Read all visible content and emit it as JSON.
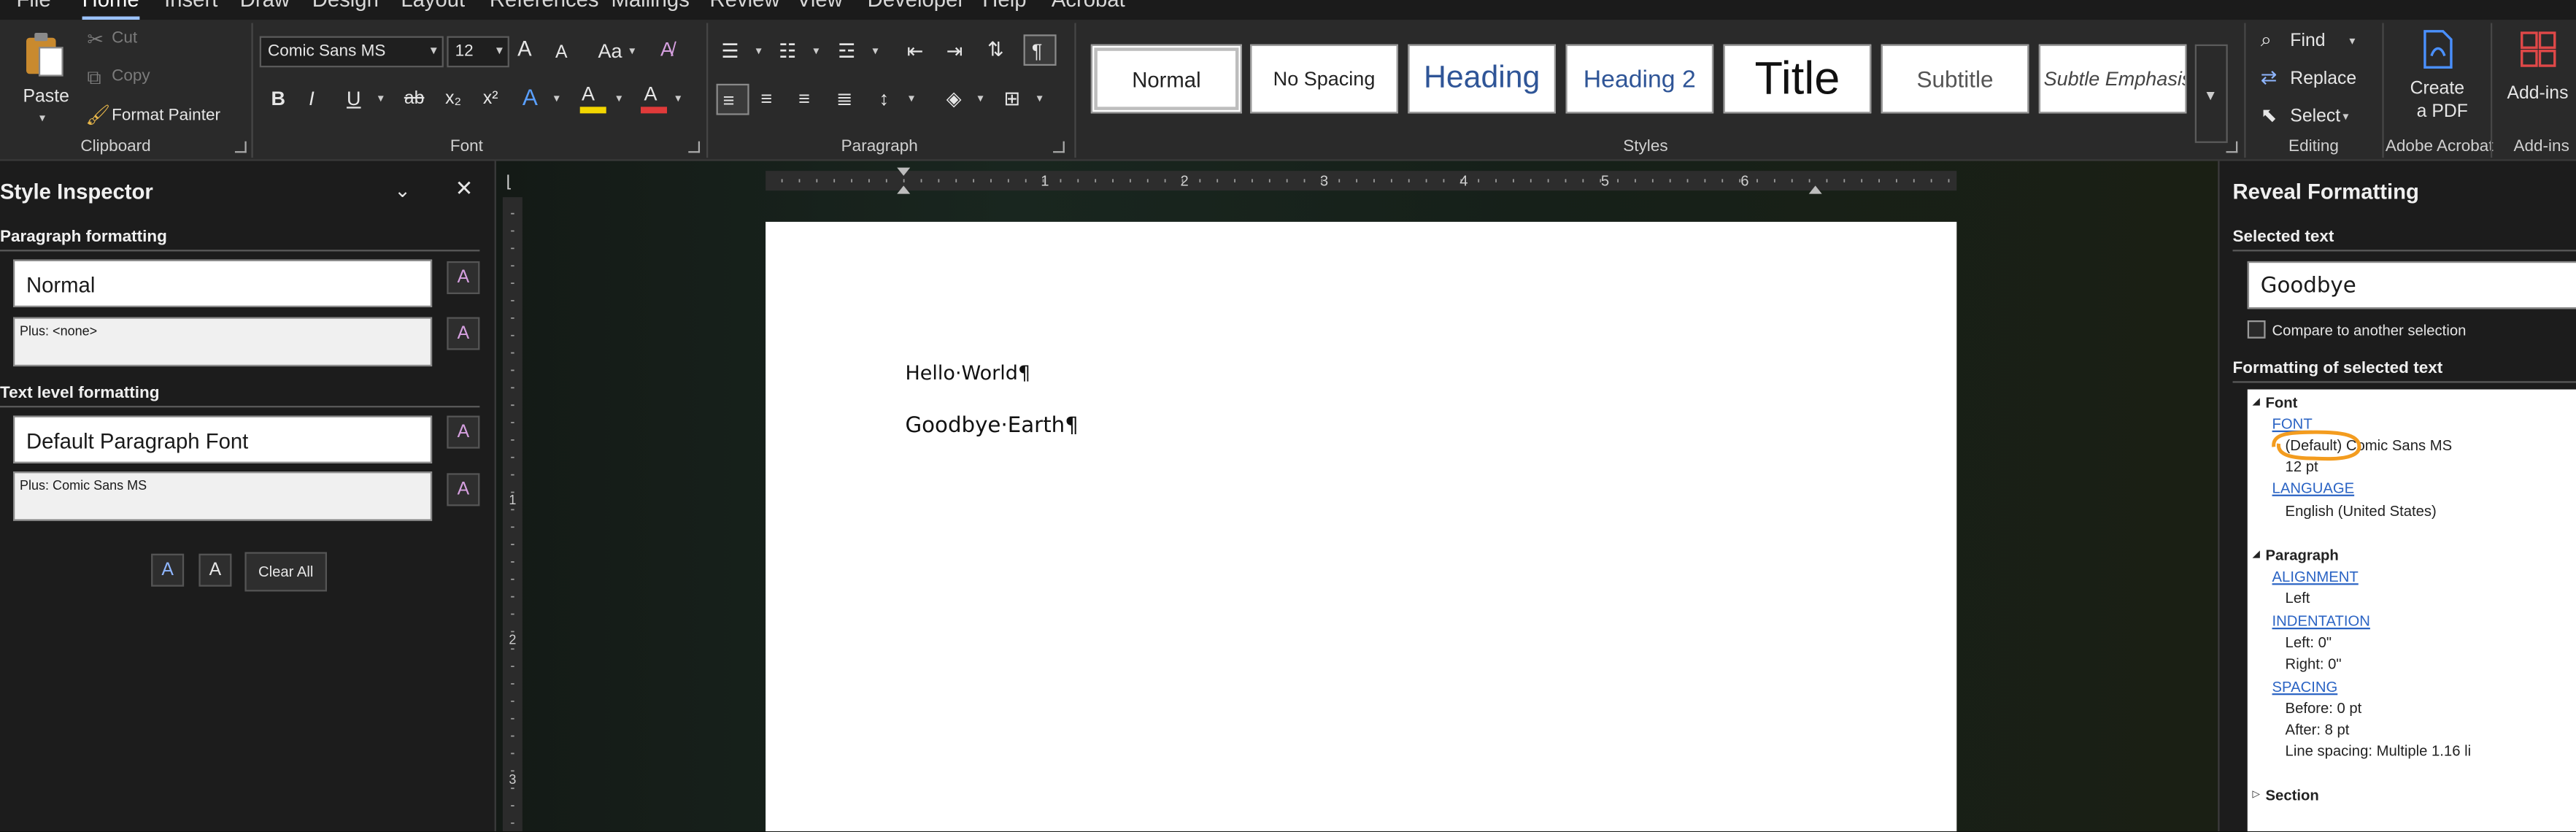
{
  "menu_tabs": [
    "File",
    "Home",
    "Insert",
    "Draw",
    "Design",
    "Layout",
    "References",
    "Mailings",
    "Review",
    "View",
    "Developer",
    "Help",
    "Acrobat"
  ],
  "clipboard": {
    "paste": "Paste",
    "cut": "Cut",
    "copy": "Copy",
    "format_painter": "Format Painter",
    "group": "Clipboard"
  },
  "font": {
    "name": "Comic Sans MS",
    "size": "12",
    "group": "Font",
    "grow": "A",
    "shrink": "A",
    "case": "Aa",
    "bold": "B",
    "italic": "I",
    "underline": "U",
    "strike": "ab",
    "sub": "x₂",
    "sup": "x²",
    "effects": "A",
    "highlight": "A",
    "color": "A"
  },
  "paragraph": {
    "group": "Paragraph"
  },
  "styles": {
    "group": "Styles",
    "items": [
      "Normal",
      "No Spacing",
      "Heading",
      "Heading 2",
      "Title",
      "Subtitle",
      "Subtle Emphasis"
    ]
  },
  "editing": {
    "find": "Find",
    "replace": "Replace",
    "select": "Select",
    "group": "Editing"
  },
  "acrobat": {
    "create_pdf_line1": "Create",
    "create_pdf_line2": "a PDF",
    "group": "Adobe Acrobat"
  },
  "addins": {
    "label": "Add-ins",
    "group": "Add-ins"
  },
  "style_inspector": {
    "title": "Style Inspector",
    "paragraph_heading": "Paragraph formatting",
    "paragraph_style": "Normal",
    "paragraph_plus": "Plus: <none>",
    "text_heading": "Text level formatting",
    "text_style": "Default Paragraph Font",
    "text_plus": "Plus: Comic Sans MS",
    "clear_all": "Clear All"
  },
  "ruler": {
    "h_numbers": [
      "1",
      "2",
      "3",
      "4",
      "5",
      "6"
    ],
    "v_numbers": [
      "1",
      "2",
      "3"
    ]
  },
  "document": {
    "line1": "Hello·World¶",
    "line2": "Goodbye·Earth¶"
  },
  "reveal": {
    "title": "Reveal Formatting",
    "selected_heading": "Selected text",
    "selected_text": "Goodbye",
    "compare_label": "Compare to another selection",
    "formatting_heading": "Formatting of selected text",
    "font_section": "Font",
    "font_link": "FONT",
    "font_value": "(Default) Comic Sans MS",
    "font_size": "12 pt",
    "language_link": "LANGUAGE",
    "language_value": "English (United States)",
    "paragraph_section": "Paragraph",
    "alignment_link": "ALIGNMENT",
    "alignment_value": "Left",
    "indentation_link": "INDENTATION",
    "indent_left": "Left:  0\"",
    "indent_right": "Right:  0\"",
    "spacing_link": "SPACING",
    "spacing_before": "Before:  0 pt",
    "spacing_after": "After:  8 pt",
    "line_spacing": "Line spacing:  Multiple 1.16 li",
    "section_section": "Section"
  },
  "colors": {
    "highlight_bar": "#f2d600",
    "font_color_bar": "#e03a3a",
    "annotation": "#f39c1f",
    "link": "#2b64c4"
  }
}
